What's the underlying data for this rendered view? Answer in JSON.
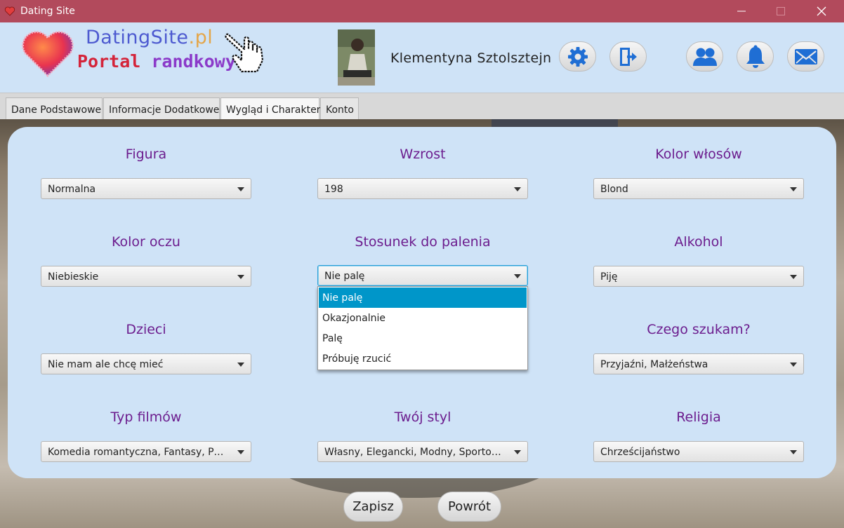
{
  "window": {
    "title": "Dating Site"
  },
  "header": {
    "logo_title_main": "DatingSite",
    "logo_title_suffix": ".pl",
    "logo_subtitle_1": "Portal",
    "logo_subtitle_2": "randkowy",
    "user_name": "Klementyna Sztolsztejn",
    "icons": [
      "settings-icon",
      "logout-icon",
      "friends-icon",
      "notifications-icon",
      "messages-icon"
    ]
  },
  "tabs": [
    {
      "label": "Dane Podstawowe",
      "active": false
    },
    {
      "label": "Informacje Dodatkowe",
      "active": false
    },
    {
      "label": "Wygląd i Charakter",
      "active": true
    },
    {
      "label": "Konto",
      "active": false
    }
  ],
  "fields": {
    "figura": {
      "label": "Figura",
      "value": "Normalna"
    },
    "wzrost": {
      "label": "Wzrost",
      "value": "198"
    },
    "kolor_wlosow": {
      "label": "Kolor włosów",
      "value": "Blond"
    },
    "kolor_oczu": {
      "label": "Kolor oczu",
      "value": "Niebieskie"
    },
    "palenie": {
      "label": "Stosunek do palenia",
      "value": "Nie palę"
    },
    "alkohol": {
      "label": "Alkohol",
      "value": "Piję"
    },
    "dzieci": {
      "label": "Dzieci",
      "value": "Nie mam ale chcę mieć"
    },
    "czego_szukam": {
      "label": "Czego szukam?",
      "value": "Przyjaźni, Małżeństwa"
    },
    "typ_filmow": {
      "label": "Typ filmów",
      "value": "Komedia romantyczna, Fantasy, Psy..."
    },
    "styl": {
      "label": "Twój styl",
      "value": "Własny, Elegancki, Modny, Sportowy"
    },
    "religia": {
      "label": "Religia",
      "value": "Chrześcijaństwo"
    }
  },
  "palenie_dropdown": {
    "options": [
      "Nie palę",
      "Okazjonalnie",
      "Palę",
      "Próbuję rzucić"
    ],
    "selected": "Nie palę"
  },
  "buttons": {
    "save": "Zapisz",
    "back": "Powrót"
  },
  "colors": {
    "titlebar": "#b24a5c",
    "panel": "#cfe3f7",
    "label": "#6c1d8e",
    "icon_blue": "#1f6ed4",
    "selection": "#0096c9"
  }
}
